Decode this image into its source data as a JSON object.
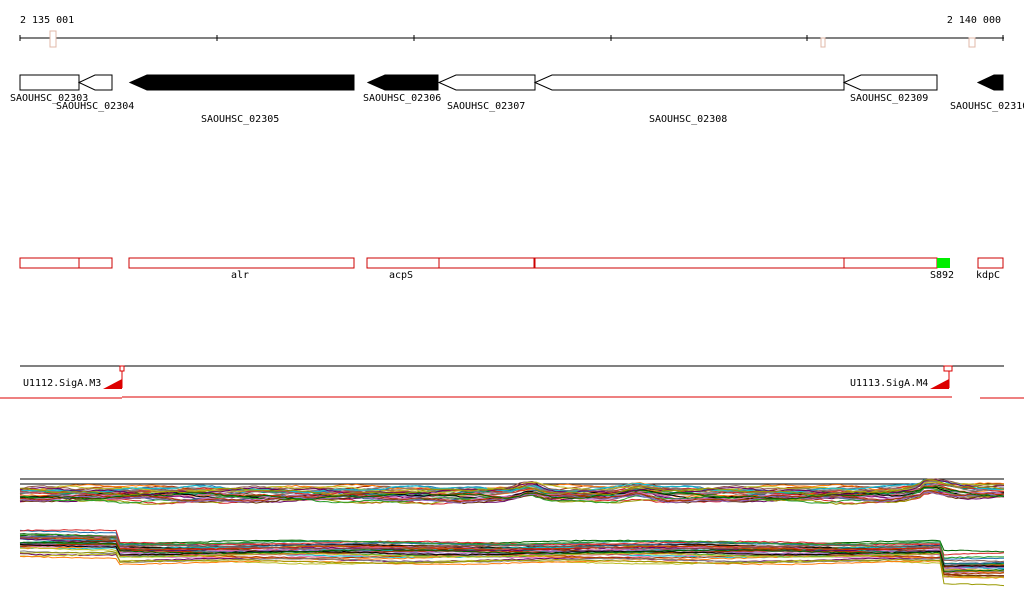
{
  "coordinate_start": "2 135 001",
  "coordinate_end": "2 140 000",
  "colors": {
    "axis": "#000000",
    "gene_fill_dark": "#000000",
    "gene_fill_light": "#ffffff",
    "feature_outline": "#cc0000",
    "feature_highlight": "#00ee00",
    "promoter": "#dd0000"
  },
  "genes": [
    {
      "id": "SAOUHSC_02303",
      "strand": "+",
      "fill": "light"
    },
    {
      "id": "SAOUHSC_02304",
      "strand": "-",
      "fill": "light"
    },
    {
      "id": "SAOUHSC_02305",
      "strand": "-",
      "fill": "dark"
    },
    {
      "id": "SAOUHSC_02306",
      "strand": "-",
      "fill": "dark"
    },
    {
      "id": "SAOUHSC_02307",
      "strand": "-",
      "fill": "light"
    },
    {
      "id": "SAOUHSC_02308",
      "strand": "-",
      "fill": "light"
    },
    {
      "id": "SAOUHSC_02309",
      "strand": "-",
      "fill": "light"
    },
    {
      "id": "SAOUHSC_02310",
      "strand": "-",
      "fill": "dark"
    }
  ],
  "features": [
    {
      "name": ""
    },
    {
      "name": ""
    },
    {
      "name": "alr"
    },
    {
      "name": "acpS"
    },
    {
      "name": ""
    },
    {
      "name": ""
    },
    {
      "name": ""
    },
    {
      "name": "S892",
      "highlight": true
    },
    {
      "name": "kdpC"
    }
  ],
  "promoters": [
    {
      "name": "U1112.SigA.M3"
    },
    {
      "name": "U1113.SigA.M4"
    }
  ]
}
